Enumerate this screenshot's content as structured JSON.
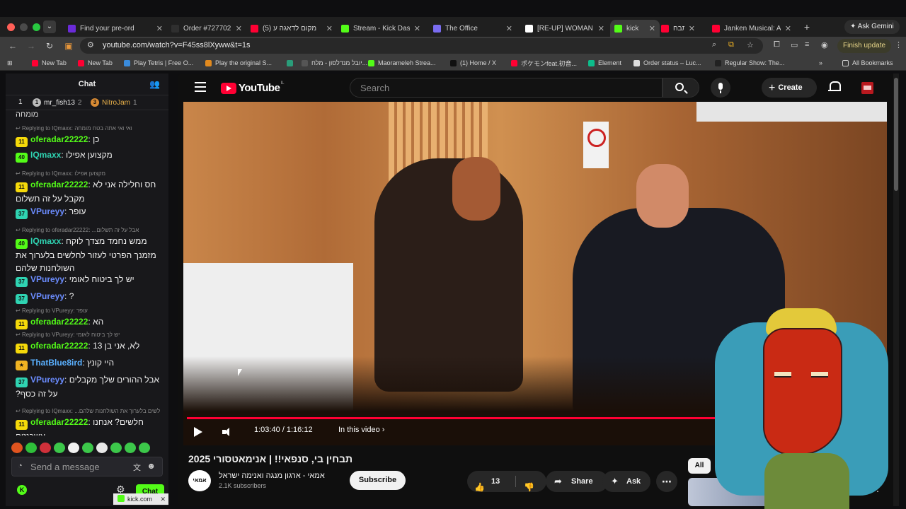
{
  "browser": {
    "tabs": [
      {
        "title": "Find your pre-ord",
        "favicon_color": "#6b2bd9"
      },
      {
        "title": "Order #727702 -",
        "favicon_color": "#2f2f2f"
      },
      {
        "title": "(5) מקום לדאגה ע",
        "favicon_color": "#ff0033"
      },
      {
        "title": "Stream - Kick Das",
        "favicon_color": "#53fc18"
      },
      {
        "title": "The Office",
        "favicon_color": "#7a6cf0"
      },
      {
        "title": "[RE-UP] WOMAN",
        "favicon_color": "#ffffff"
      },
      {
        "title": "kick",
        "favicon_color": "#53fc18"
      },
      {
        "title": "תבח",
        "favicon_color": "#ff0033"
      },
      {
        "title": "Janken Musical: A",
        "favicon_color": "#ff0033"
      }
    ],
    "active_tab_index": 6,
    "ask_gemini": "Ask Gemini",
    "url": "youtube.com/watch?v=F45ss8lXyww&t=1s",
    "finish_update": "Finish update",
    "bookmarks": [
      {
        "label": "New Tab",
        "color": "#ff0033"
      },
      {
        "label": "New Tab",
        "color": "#ff0033"
      },
      {
        "label": "Play Tetris | Free O...",
        "color": "#3a8bdc"
      },
      {
        "label": "Play the original S...",
        "color": "#e28a1e"
      },
      {
        "label": "",
        "color": "#2a9d7a"
      },
      {
        "label": "יובל מנדלסון - מלח...",
        "color": "#555555"
      },
      {
        "label": "Maorameleh Strea...",
        "color": "#53fc18"
      },
      {
        "label": "(1) Home / X",
        "color": "#111111"
      },
      {
        "label": "ポケモンfeat.初音...",
        "color": "#ff0033"
      },
      {
        "label": "Element",
        "color": "#0dbd8b"
      },
      {
        "label": "Order status – Luc...",
        "color": "#dddddd"
      },
      {
        "label": "Regular Show: The...",
        "color": "#222222"
      }
    ],
    "all_bookmarks": "All Bookmarks"
  },
  "chat": {
    "title": "Chat",
    "leaders": [
      {
        "rank": "1",
        "name": "mr_fish13",
        "score": "2",
        "color": "#bbbbbb"
      },
      {
        "rank": "3",
        "name": "NitroJam",
        "score": "1",
        "color": "#d98b34"
      }
    ],
    "top_fragment": "מומחה",
    "messages": [
      {
        "reply": "Replying to IQmaxx: ואי ואי אתה בטח מומחה",
        "badge": "11",
        "badge_color": "#f5d90a",
        "user": "oferadar22222",
        "user_color": "#53fc18",
        "text": "כן"
      },
      {
        "reply": "",
        "badge": "40",
        "badge_color": "#53fc18",
        "user": "IQmaxx",
        "user_color": "#2fd3b2",
        "text": "מקצוען אפילו"
      },
      {
        "reply": "Replying to IQmaxx: מקצוען אפילו",
        "badge": "11",
        "badge_color": "#f5d90a",
        "user": "oferadar22222",
        "user_color": "#53fc18",
        "text": "חס וחלילה אני לא מקבל על זה תשלום"
      },
      {
        "reply": "",
        "badge": "37",
        "badge_color": "#2fd3b2",
        "user": "VPureyy",
        "user_color": "#6b8cff",
        "text": "עופר"
      },
      {
        "reply": "Replying to oferadar22222: ...אבל על זה תשלום",
        "badge": "40",
        "badge_color": "#53fc18",
        "user": "IQmaxx",
        "user_color": "#2fd3b2",
        "text": "ממש נחמד מצדך לוקח מזמנך הפרטי לעזור לחלשים בלערוך את השולחנות שלהם"
      },
      {
        "reply": "",
        "badge": "37",
        "badge_color": "#2fd3b2",
        "user": "VPureyy",
        "user_color": "#6b8cff",
        "text": "יש לך ביטוח לאומי"
      },
      {
        "reply": "",
        "badge": "37",
        "badge_color": "#2fd3b2",
        "user": "VPureyy",
        "user_color": "#6b8cff",
        "text": "?"
      },
      {
        "reply": "Replying to VPureyy: עופר",
        "badge": "11",
        "badge_color": "#f5d90a",
        "user": "oferadar22222",
        "user_color": "#53fc18",
        "text": "הא"
      },
      {
        "reply": "Replying to VPureyy: יש לך ביטוח לאומי",
        "badge": "11",
        "badge_color": "#f5d90a",
        "user": "oferadar22222",
        "user_color": "#53fc18",
        "text": "לא, אני בן 13"
      },
      {
        "reply": "",
        "badge": "★",
        "badge_color": "#f0b323",
        "user": "ThatBlue8ird",
        "user_color": "#5ab0ff",
        "text": "היי קונץ"
      },
      {
        "reply": "",
        "badge": "37",
        "badge_color": "#2fd3b2",
        "user": "VPureyy",
        "user_color": "#6b8cff",
        "text": "אבל ההורים שלך מקבלים על זה כסף?"
      },
      {
        "reply": "Replying to IQmaxx: ...לעזור לחלשים בלערוך את השולחנות שלהם",
        "badge": "11",
        "badge_color": "#f5d90a",
        "user": "oferadar22222",
        "user_color": "#53fc18",
        "text": "חלשים? אנחנו אשכנזים"
      }
    ],
    "emote_colors": [
      "#e0541f",
      "#2fbf3a",
      "#d0303a",
      "#3cc74a",
      "#f2f2f2",
      "#3cc74a",
      "#e8e8e8",
      "#3cc74a",
      "#3cc74a",
      "#3cc74a"
    ],
    "input_placeholder": "Send a message",
    "send_label": "Chat",
    "share_text": "kick.com"
  },
  "youtube": {
    "logo_text": "YouTube",
    "country": "IL",
    "search_placeholder": "Search",
    "create_label": "Create",
    "video": {
      "progress": 0.865,
      "current_time": "1:03:40",
      "duration": "1:16:12",
      "in_this_video": "In this video",
      "title": "תבחין בי, סנפאי!! | אנימאטסורי 2025"
    },
    "channel": {
      "avatar_text": "אמאי",
      "name": "אמאי - ארגון מנגה ואנימה ישראל",
      "subscribers": "2.1K subscribers",
      "subscribe_label": "Subscribe"
    },
    "likes": "13",
    "share_label": "Share",
    "ask_label": "Ask",
    "chips": {
      "all": "All",
      "second": "F"
    }
  }
}
